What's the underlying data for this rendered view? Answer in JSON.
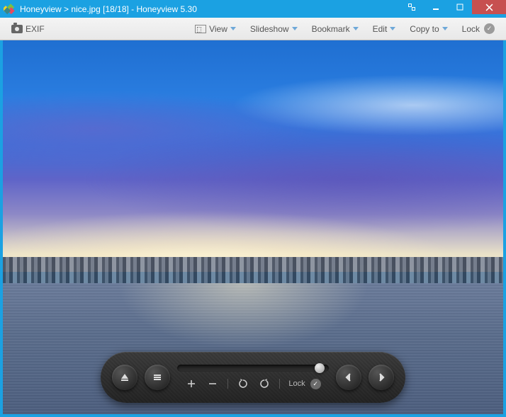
{
  "titlebar": {
    "app_name": "Honeyview",
    "separator": ">",
    "filename": "nice.jpg",
    "counter": "[18/18]",
    "suffix": "- Honeyview 5.30"
  },
  "toolbar": {
    "exif_label": "EXIF",
    "view_label": "View",
    "slideshow_label": "Slideshow",
    "bookmark_label": "Bookmark",
    "edit_label": "Edit",
    "copyto_label": "Copy to",
    "lock_label": "Lock"
  },
  "overlay": {
    "lock_label": "Lock"
  }
}
